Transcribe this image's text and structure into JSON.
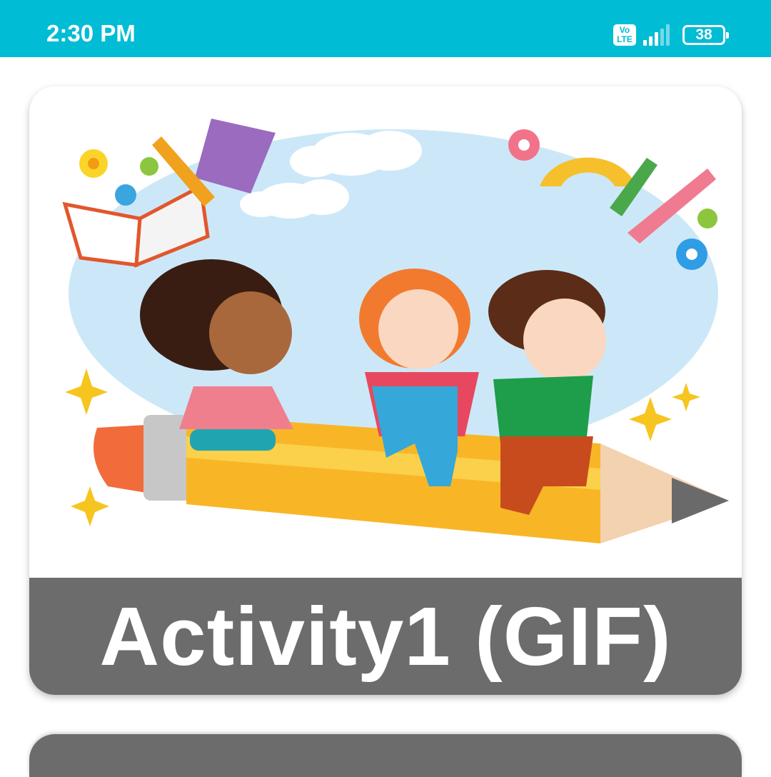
{
  "status_bar": {
    "time": "2:30 PM",
    "volte_line1": "Vo",
    "volte_line2": "LTE",
    "battery_level": "38",
    "icons": [
      "volte-icon",
      "signal-icon",
      "battery-icon"
    ]
  },
  "cards": [
    {
      "title": "Activity1 (GIF)",
      "image": "kids-riding-pencil-illustration"
    }
  ],
  "colors": {
    "status_bar": "#00bcd4",
    "caption_bg": "#6c6c6c",
    "caption_text": "#ffffff"
  }
}
